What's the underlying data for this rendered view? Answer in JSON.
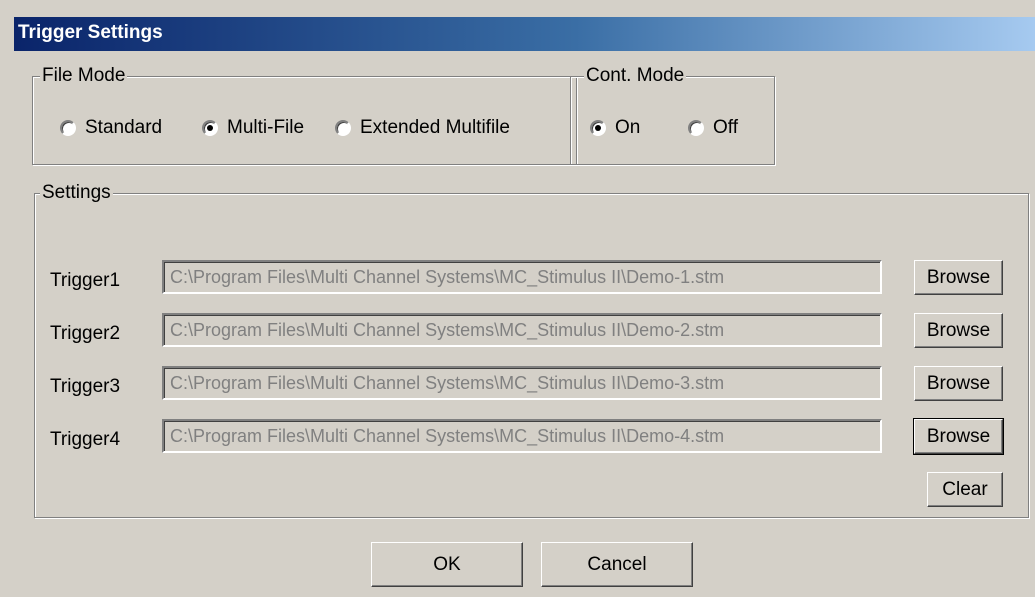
{
  "window": {
    "title": "Trigger Settings"
  },
  "file_mode": {
    "label": "File Mode",
    "options": [
      {
        "label": "Standard",
        "checked": false
      },
      {
        "label": "Multi-File",
        "checked": true
      },
      {
        "label": "Extended Multifile",
        "checked": false
      }
    ]
  },
  "cont_mode": {
    "label": "Cont. Mode",
    "options": [
      {
        "label": "On",
        "checked": true
      },
      {
        "label": "Off",
        "checked": false
      }
    ]
  },
  "settings": {
    "label": "Settings",
    "triggers": [
      {
        "label": "Trigger1",
        "path": "C:\\Program Files\\Multi Channel Systems\\MC_Stimulus II\\Demo-1.stm",
        "browse": "Browse"
      },
      {
        "label": "Trigger2",
        "path": "C:\\Program Files\\Multi Channel Systems\\MC_Stimulus II\\Demo-2.stm",
        "browse": "Browse"
      },
      {
        "label": "Trigger3",
        "path": "C:\\Program Files\\Multi Channel Systems\\MC_Stimulus II\\Demo-3.stm",
        "browse": "Browse"
      },
      {
        "label": "Trigger4",
        "path": "C:\\Program Files\\Multi Channel Systems\\MC_Stimulus II\\Demo-4.stm",
        "browse": "Browse"
      }
    ],
    "clear_label": "Clear"
  },
  "buttons": {
    "ok": "OK",
    "cancel": "Cancel"
  }
}
